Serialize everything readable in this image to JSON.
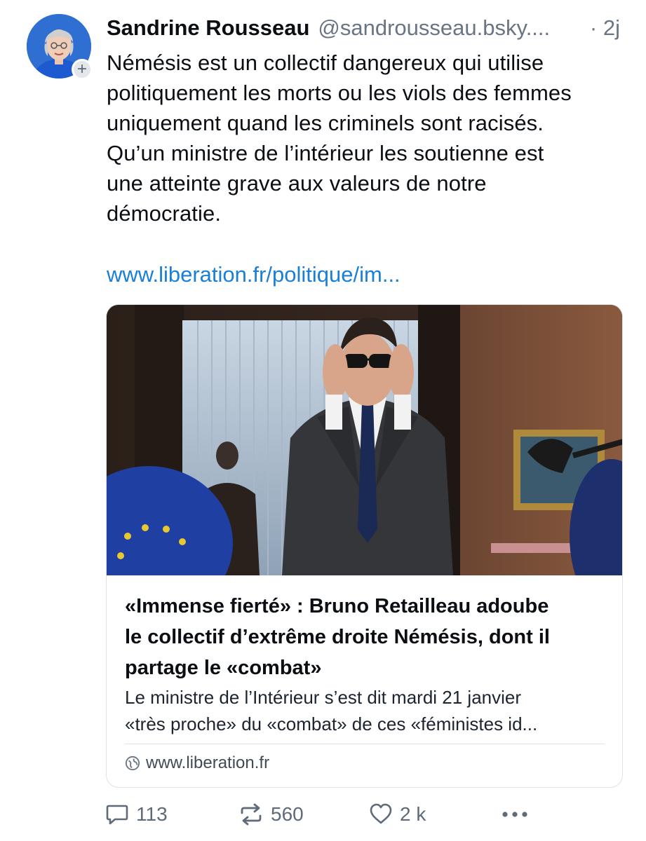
{
  "post": {
    "author_name": "Sandrine Rousseau",
    "author_handle": "@sandrousseau.bsky....",
    "time": "· 2j",
    "text_lines": [
      "Némésis est un collectif dangereux qui utilise",
      "politiquement les morts ou les viols des femmes",
      "uniquement quand les criminels sont racisés.",
      "Qu’un ministre de l’intérieur les soutienne est",
      "une atteinte grave aux valeurs de notre",
      "démocratie."
    ],
    "link_text": "www.liberation.fr/politique/im..."
  },
  "card": {
    "title_lines": [
      "«Immense fierté» : Bruno Retailleau adoube",
      "le collectif d’extrême droite Némésis, dont il",
      "partage le «combat»"
    ],
    "description_lines": [
      "Le ministre de l’Intérieur s’est dit mardi 21 janvier",
      "«très proche» du «combat» de ces «féministes id..."
    ],
    "domain": "www.liberation.fr"
  },
  "actions": {
    "replies": "113",
    "reposts": "560",
    "likes": "2 k",
    "more_icon": "more-horizontal-icon"
  },
  "colors": {
    "link": "#1a7fd6",
    "muted": "#6a7583",
    "text": "#0b0f14"
  }
}
